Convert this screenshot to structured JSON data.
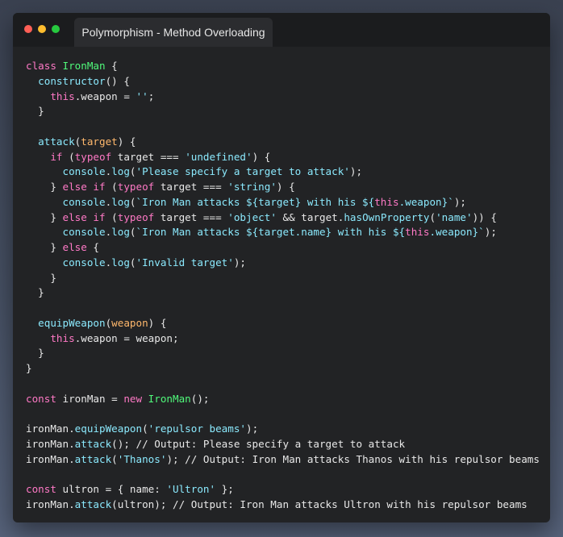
{
  "window": {
    "tab_title": "Polymorphism - Method Overloading"
  },
  "colors": {
    "keyword": "#ff79c6",
    "class_name": "#50fa7b",
    "method": "#8be9fd",
    "param": "#ffb86c",
    "string": "#8be9fd",
    "plain": "#e8e8e8",
    "close_dot": "#ff5f56",
    "min_dot": "#ffbd2e",
    "max_dot": "#27c93f"
  },
  "code_lines": [
    [
      [
        "k",
        "class"
      ],
      [
        "p",
        " "
      ],
      [
        "c",
        "IronMan"
      ],
      [
        "p",
        " {"
      ]
    ],
    [
      [
        "p",
        "  "
      ],
      [
        "m",
        "constructor"
      ],
      [
        "p",
        "() {"
      ]
    ],
    [
      [
        "p",
        "    "
      ],
      [
        "k",
        "this"
      ],
      [
        "p",
        ".weapon = "
      ],
      [
        "s",
        "''"
      ],
      [
        "p",
        ";"
      ]
    ],
    [
      [
        "p",
        "  }"
      ]
    ],
    [
      [
        "p",
        ""
      ]
    ],
    [
      [
        "p",
        "  "
      ],
      [
        "m",
        "attack"
      ],
      [
        "p",
        "("
      ],
      [
        "a",
        "target"
      ],
      [
        "p",
        ") {"
      ]
    ],
    [
      [
        "p",
        "    "
      ],
      [
        "k",
        "if"
      ],
      [
        "p",
        " ("
      ],
      [
        "k",
        "typeof"
      ],
      [
        "p",
        " target === "
      ],
      [
        "s",
        "'undefined'"
      ],
      [
        "p",
        ") {"
      ]
    ],
    [
      [
        "p",
        "      "
      ],
      [
        "m",
        "console"
      ],
      [
        "p",
        "."
      ],
      [
        "m",
        "log"
      ],
      [
        "p",
        "("
      ],
      [
        "s",
        "'Please specify a target to attack'"
      ],
      [
        "p",
        ");"
      ]
    ],
    [
      [
        "p",
        "    } "
      ],
      [
        "k",
        "else if"
      ],
      [
        "p",
        " ("
      ],
      [
        "k",
        "typeof"
      ],
      [
        "p",
        " target === "
      ],
      [
        "s",
        "'string'"
      ],
      [
        "p",
        ") {"
      ]
    ],
    [
      [
        "p",
        "      "
      ],
      [
        "m",
        "console"
      ],
      [
        "p",
        "."
      ],
      [
        "m",
        "log"
      ],
      [
        "p",
        "("
      ],
      [
        "s",
        "`Iron Man attacks ${target} with his ${"
      ],
      [
        "k",
        "this"
      ],
      [
        "s",
        ".weapon}`"
      ],
      [
        "p",
        ");"
      ]
    ],
    [
      [
        "p",
        "    } "
      ],
      [
        "k",
        "else if"
      ],
      [
        "p",
        " ("
      ],
      [
        "k",
        "typeof"
      ],
      [
        "p",
        " target === "
      ],
      [
        "s",
        "'object'"
      ],
      [
        "p",
        " && target."
      ],
      [
        "m",
        "hasOwnProperty"
      ],
      [
        "p",
        "("
      ],
      [
        "s",
        "'name'"
      ],
      [
        "p",
        ")) {"
      ]
    ],
    [
      [
        "p",
        "      "
      ],
      [
        "m",
        "console"
      ],
      [
        "p",
        "."
      ],
      [
        "m",
        "log"
      ],
      [
        "p",
        "("
      ],
      [
        "s",
        "`Iron Man attacks ${target.name} with his ${"
      ],
      [
        "k",
        "this"
      ],
      [
        "s",
        ".weapon}`"
      ],
      [
        "p",
        ");"
      ]
    ],
    [
      [
        "p",
        "    } "
      ],
      [
        "k",
        "else"
      ],
      [
        "p",
        " {"
      ]
    ],
    [
      [
        "p",
        "      "
      ],
      [
        "m",
        "console"
      ],
      [
        "p",
        "."
      ],
      [
        "m",
        "log"
      ],
      [
        "p",
        "("
      ],
      [
        "s",
        "'Invalid target'"
      ],
      [
        "p",
        ");"
      ]
    ],
    [
      [
        "p",
        "    }"
      ]
    ],
    [
      [
        "p",
        "  }"
      ]
    ],
    [
      [
        "p",
        ""
      ]
    ],
    [
      [
        "p",
        "  "
      ],
      [
        "m",
        "equipWeapon"
      ],
      [
        "p",
        "("
      ],
      [
        "a",
        "weapon"
      ],
      [
        "p",
        ") {"
      ]
    ],
    [
      [
        "p",
        "    "
      ],
      [
        "k",
        "this"
      ],
      [
        "p",
        ".weapon = weapon;"
      ]
    ],
    [
      [
        "p",
        "  }"
      ]
    ],
    [
      [
        "p",
        "}"
      ]
    ],
    [
      [
        "p",
        ""
      ]
    ],
    [
      [
        "k",
        "const"
      ],
      [
        "p",
        " ironMan = "
      ],
      [
        "k",
        "new"
      ],
      [
        "p",
        " "
      ],
      [
        "c",
        "IronMan"
      ],
      [
        "p",
        "();"
      ]
    ],
    [
      [
        "p",
        ""
      ]
    ],
    [
      [
        "p",
        "ironMan."
      ],
      [
        "m",
        "equipWeapon"
      ],
      [
        "p",
        "("
      ],
      [
        "s",
        "'repulsor beams'"
      ],
      [
        "p",
        ");"
      ]
    ],
    [
      [
        "p",
        "ironMan."
      ],
      [
        "m",
        "attack"
      ],
      [
        "p",
        "(); // Output: Please specify a target to attack"
      ]
    ],
    [
      [
        "p",
        "ironMan."
      ],
      [
        "m",
        "attack"
      ],
      [
        "p",
        "("
      ],
      [
        "s",
        "'Thanos'"
      ],
      [
        "p",
        "); // Output: Iron Man attacks Thanos with his repulsor beams"
      ]
    ],
    [
      [
        "p",
        ""
      ]
    ],
    [
      [
        "k",
        "const"
      ],
      [
        "p",
        " ultron = { name: "
      ],
      [
        "s",
        "'Ultron'"
      ],
      [
        "p",
        " };"
      ]
    ],
    [
      [
        "p",
        "ironMan."
      ],
      [
        "m",
        "attack"
      ],
      [
        "p",
        "(ultron); // Output: Iron Man attacks Ultron with his repulsor beams"
      ]
    ]
  ]
}
